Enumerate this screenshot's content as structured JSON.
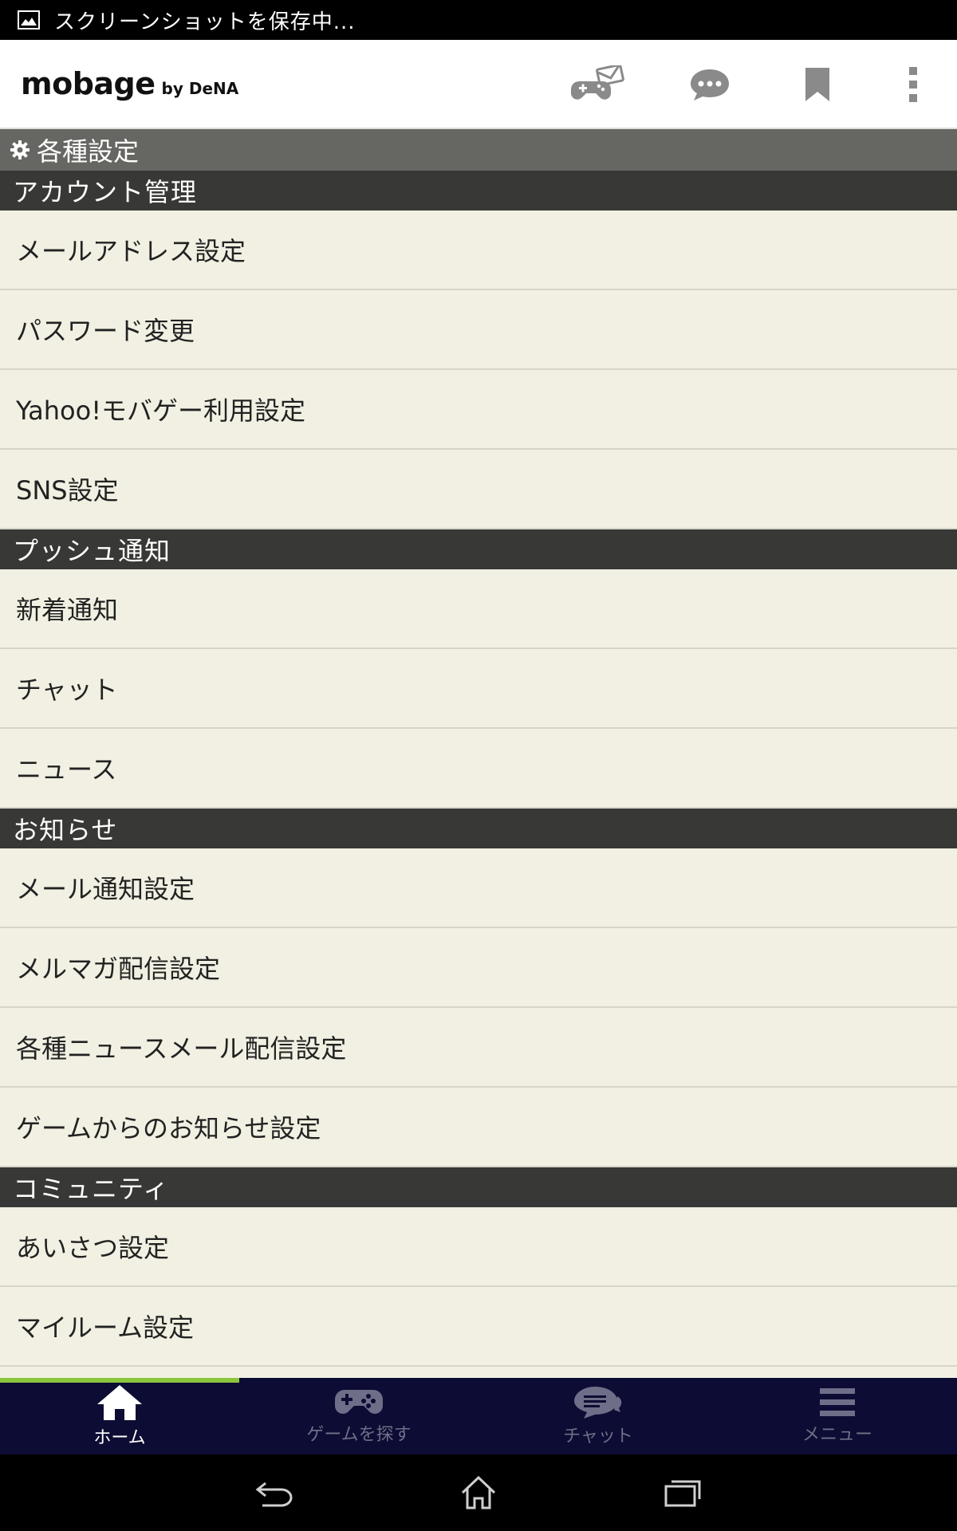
{
  "status_bar": {
    "text": "スクリーンショットを保存中..."
  },
  "header": {
    "logo_main": "mobage",
    "logo_sub": "by DeNA",
    "icons": [
      "game-mail-icon",
      "chat-bubble-icon",
      "bookmark-icon",
      "overflow-menu-icon"
    ]
  },
  "page_title": "各種設定",
  "sections": [
    {
      "title": "アカウント管理",
      "items": [
        "メールアドレス設定",
        "パスワード変更",
        "Yahoo!モバゲー利用設定",
        "SNS設定"
      ]
    },
    {
      "title": "プッシュ通知",
      "items": [
        "新着通知",
        "チャット",
        "ニュース"
      ]
    },
    {
      "title": "お知らせ",
      "items": [
        "メール通知設定",
        "メルマガ配信設定",
        "各種ニュースメール配信設定",
        "ゲームからのお知らせ設定"
      ]
    },
    {
      "title": "コミュニティ",
      "items": [
        "あいさつ設定",
        "マイルーム設定"
      ]
    }
  ],
  "bottom_nav": {
    "items": [
      {
        "label": "ホーム",
        "active": true
      },
      {
        "label": "ゲームを探す",
        "active": false
      },
      {
        "label": "チャット",
        "active": false
      },
      {
        "label": "メニュー",
        "active": false
      }
    ]
  },
  "colors": {
    "list_bg": "#f1f0e2",
    "section_bg": "#383836",
    "title_bg": "#666662",
    "nav_bg": "#0c0c34",
    "accent": "#8cc63e"
  }
}
